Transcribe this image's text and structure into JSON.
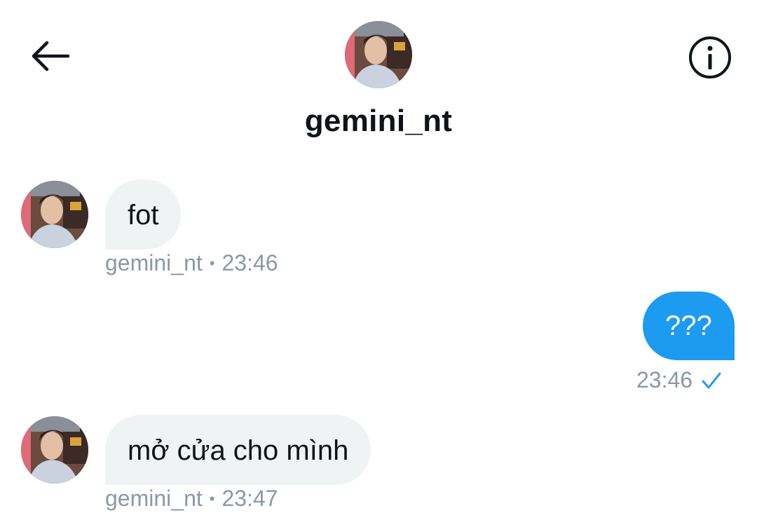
{
  "header": {
    "title": "gemini_nt",
    "back_icon": "arrow-left-icon",
    "info_icon": "info-icon"
  },
  "messages": [
    {
      "direction": "incoming",
      "text": "fot",
      "sender": "gemini_nt",
      "time": "23:46"
    },
    {
      "direction": "outgoing",
      "text": "???",
      "time": "23:46",
      "status_icon": "check-icon"
    },
    {
      "direction": "incoming",
      "text": "mở cửa cho mình",
      "sender": "gemini_nt",
      "time": "23:47"
    }
  ],
  "meta_separator": "•",
  "colors": {
    "outgoing_bubble": "#1d9bf0",
    "incoming_bubble": "#eff3f4",
    "meta_text": "#8b98a5",
    "check": "#1d9bf0"
  }
}
